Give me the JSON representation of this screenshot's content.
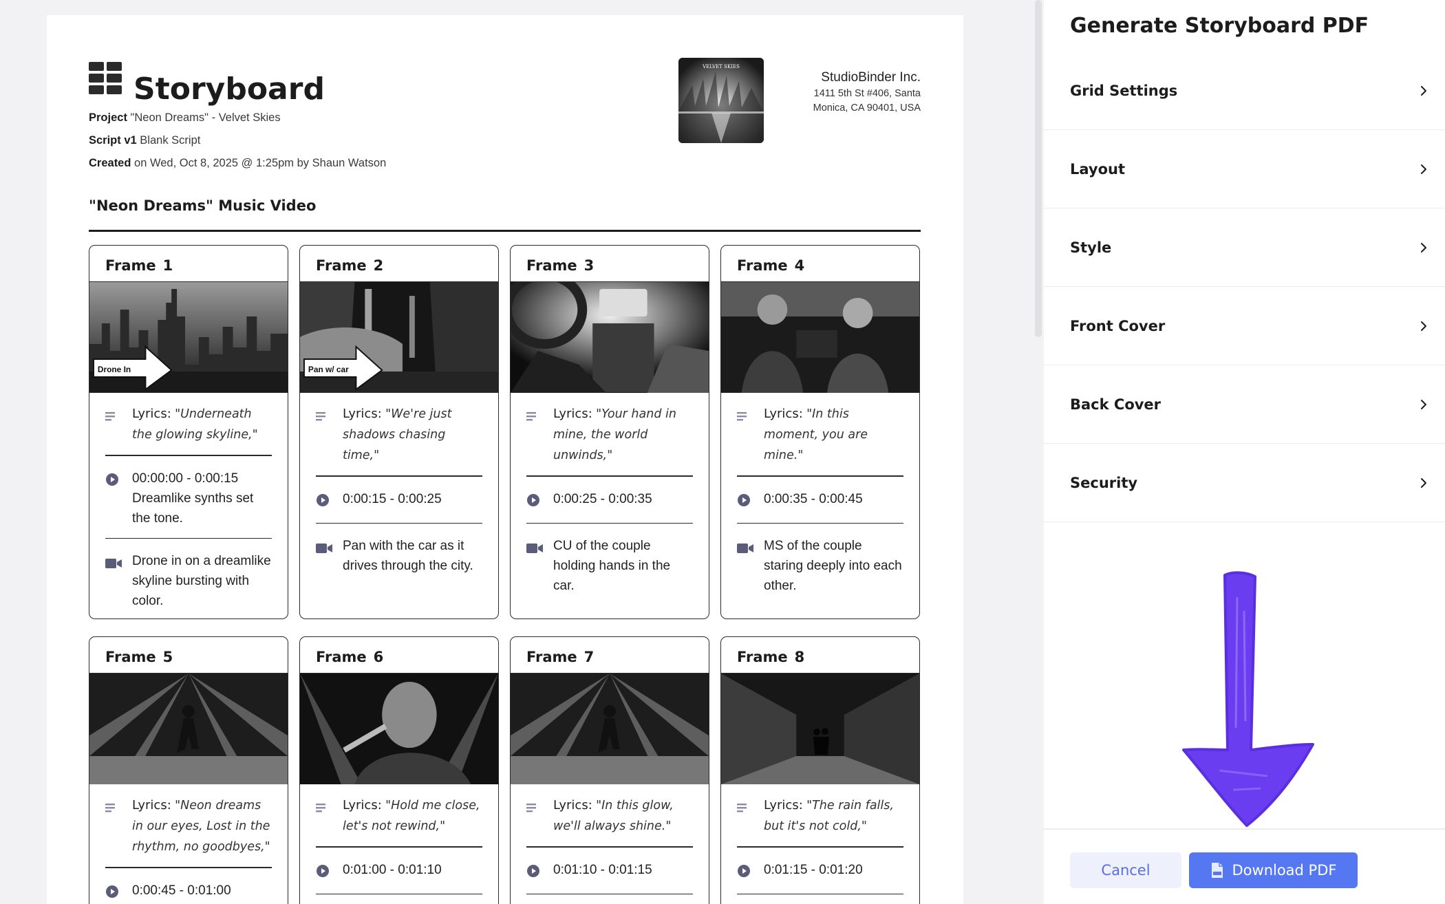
{
  "document": {
    "title": "Storyboard",
    "project_label": "Project",
    "project_value": "\"Neon Dreams\" - Velvet Skies",
    "script_label": "Script v1",
    "script_value": "Blank Script",
    "created_label": "Created",
    "created_value": "on Wed, Oct 8, 2025 @ 1:25pm by Shaun Watson",
    "company_name": "StudioBinder Inc.",
    "company_address_line1": "1411 5th St #406, Santa",
    "company_address_line2": "Monica, CA 90401, USA",
    "company_thumb_text": "VELVET SKIES",
    "heading": "\"Neon Dreams\" Music Video"
  },
  "frames": [
    {
      "label": "Frame",
      "number": "1",
      "lyrics_label": "Lyrics:",
      "lyrics": "\"Underneath the glowing skyline,\"",
      "time": "00:00:00 - 0:00:15",
      "audio_note": "Dreamlike synths set the tone.",
      "shot": "Drone in on a dreamlike skyline bursting with color.",
      "overlay": "Drone In",
      "scene": "skyline"
    },
    {
      "label": "Frame",
      "number": "2",
      "lyrics_label": "Lyrics:",
      "lyrics": "\"We're just shadows chasing time,\"",
      "time": "0:00:15 - 0:00:25",
      "shot": "Pan with the car as it drives through the city.",
      "overlay": "Pan w/ car",
      "scene": "car-street"
    },
    {
      "label": "Frame",
      "number": "3",
      "lyrics_label": "Lyrics:",
      "lyrics": "\"Your hand in mine, the world unwinds,\"",
      "time": "0:00:25 - 0:00:35",
      "shot": "CU of the couple holding hands in the car.",
      "scene": "car-interior"
    },
    {
      "label": "Frame",
      "number": "4",
      "lyrics_label": "Lyrics:",
      "lyrics": "\"In this moment, you are mine.\"",
      "time": "0:00:35 - 0:00:45",
      "shot": "MS of the couple staring deeply into each other.",
      "scene": "couple-car"
    },
    {
      "label": "Frame",
      "number": "5",
      "lyrics_label": "Lyrics:",
      "lyrics": "\"Neon dreams in our eyes, Lost in the rhythm, no goodbyes,\"",
      "time": "0:00:45 - 0:01:00",
      "scene": "stage"
    },
    {
      "label": "Frame",
      "number": "6",
      "lyrics_label": "Lyrics:",
      "lyrics": "\"Hold me close, let's not rewind,\"",
      "time": "0:01:00 - 0:01:10",
      "scene": "singer-closeup"
    },
    {
      "label": "Frame",
      "number": "7",
      "lyrics_label": "Lyrics:",
      "lyrics": "\"In this glow, we'll always shine.\"",
      "time": "0:01:10 - 0:01:15",
      "scene": "stage"
    },
    {
      "label": "Frame",
      "number": "8",
      "lyrics_label": "Lyrics:",
      "lyrics": "\"The rain falls, but it's not cold,\"",
      "time": "0:01:15 - 0:01:20",
      "scene": "rain-alley"
    }
  ],
  "panel": {
    "title": "Generate Storyboard PDF",
    "sections": [
      "Grid Settings",
      "Layout",
      "Style",
      "Front Cover",
      "Back Cover",
      "Security"
    ],
    "cancel_label": "Cancel",
    "download_label": "Download PDF"
  },
  "colors": {
    "accent": "#5577f2",
    "annotation_arrow": "#6a3df0",
    "icon_gray": "#6b6b8a"
  }
}
